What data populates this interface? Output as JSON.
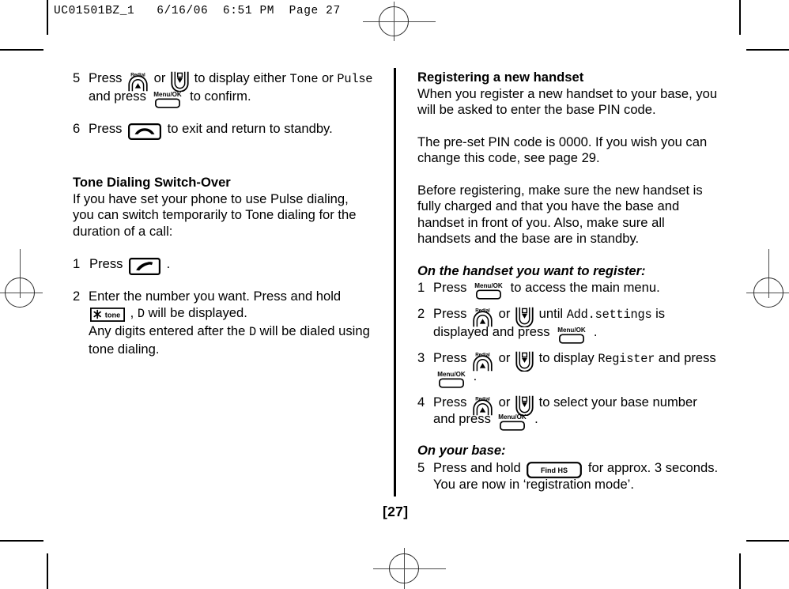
{
  "slug": {
    "text": "UC01501BZ_1   6/16/06  6:51 PM  Page 27"
  },
  "folio": {
    "page_number": "[27]"
  },
  "left_column": {
    "steps_continued": [
      {
        "number": "5",
        "parts": [
          {
            "type": "text",
            "value": "Press "
          },
          {
            "type": "icon",
            "icon": "redial-up-key"
          },
          {
            "type": "text",
            "value": " or "
          },
          {
            "type": "icon",
            "icon": "down-arrow-key"
          },
          {
            "type": "text",
            "value": " to display either "
          },
          {
            "type": "lcd",
            "value": "Tone"
          },
          {
            "type": "text",
            "value": " or "
          },
          {
            "type": "lcd",
            "value": "Pulse"
          },
          {
            "type": "text",
            "value": " and press "
          },
          {
            "type": "icon",
            "icon": "menu-ok-key"
          },
          {
            "type": "text",
            "value": " to confirm."
          }
        ]
      },
      {
        "number": "6",
        "parts": [
          {
            "type": "text",
            "value": "Press "
          },
          {
            "type": "icon",
            "icon": "hangup-key"
          },
          {
            "type": "text",
            "value": " to exit and return to standby."
          }
        ]
      }
    ],
    "section": {
      "heading": "Tone Dialing Switch-Over",
      "intro": "If you have set your phone to use Pulse dialing, you can switch temporarily to Tone dialing for the duration of a call:",
      "steps": [
        {
          "number": "1",
          "parts": [
            {
              "type": "text",
              "value": "Press "
            },
            {
              "type": "icon",
              "icon": "talk-key"
            },
            {
              "type": "text",
              "value": " ."
            }
          ]
        },
        {
          "number": "2",
          "parts": [
            {
              "type": "text",
              "value": "Enter the number you want. Press and hold "
            },
            {
              "type": "icon",
              "icon": "star-tone-key"
            },
            {
              "type": "text",
              "value": " , "
            },
            {
              "type": "lcd",
              "value": "D"
            },
            {
              "type": "text",
              "value": " will be displayed."
            },
            {
              "type": "break"
            },
            {
              "type": "text",
              "value": "Any digits entered after the "
            },
            {
              "type": "lcd",
              "value": "D"
            },
            {
              "type": "text",
              "value": " will be dialed using tone dialing."
            }
          ]
        }
      ]
    }
  },
  "right_column": {
    "heading": "Registering a new handset",
    "paragraphs": [
      "When you register a new handset to your base, you will be asked to enter the base PIN code.",
      "The pre-set PIN code is 0000. If you wish you can change this code, see page 29.",
      "Before registering, make sure the new handset is fully charged and that you have the base and handset in front of you. Also, make sure all handsets and the base are in standby."
    ],
    "handset_subheading": "On the handset you want to register:",
    "handset_steps": [
      {
        "number": "1",
        "parts": [
          {
            "type": "text",
            "value": "Press "
          },
          {
            "type": "icon",
            "icon": "menu-ok-key"
          },
          {
            "type": "text",
            "value": " to access the main menu."
          }
        ]
      },
      {
        "number": "2",
        "parts": [
          {
            "type": "text",
            "value": "Press "
          },
          {
            "type": "icon",
            "icon": "redial-up-key"
          },
          {
            "type": "text",
            "value": " or "
          },
          {
            "type": "icon",
            "icon": "down-arrow-key"
          },
          {
            "type": "text",
            "value": " until "
          },
          {
            "type": "lcd",
            "value": "Add.settings"
          },
          {
            "type": "text",
            "value": " is displayed and press "
          },
          {
            "type": "icon",
            "icon": "menu-ok-key"
          },
          {
            "type": "text",
            "value": " ."
          }
        ]
      },
      {
        "number": "3",
        "parts": [
          {
            "type": "text",
            "value": "Press "
          },
          {
            "type": "icon",
            "icon": "redial-up-key"
          },
          {
            "type": "text",
            "value": " or "
          },
          {
            "type": "icon",
            "icon": "down-arrow-key"
          },
          {
            "type": "text",
            "value": " to display "
          },
          {
            "type": "lcd",
            "value": "Register"
          },
          {
            "type": "text",
            "value": " and press "
          },
          {
            "type": "icon",
            "icon": "menu-ok-key"
          },
          {
            "type": "text",
            "value": " ."
          }
        ]
      },
      {
        "number": "4",
        "parts": [
          {
            "type": "text",
            "value": "Press "
          },
          {
            "type": "icon",
            "icon": "redial-up-key"
          },
          {
            "type": "text",
            "value": " or "
          },
          {
            "type": "icon",
            "icon": "down-arrow-key"
          },
          {
            "type": "text",
            "value": " to select your base number and press "
          },
          {
            "type": "icon",
            "icon": "menu-ok-key"
          },
          {
            "type": "text",
            "value": " ."
          }
        ]
      }
    ],
    "base_subheading": "On your base:",
    "base_steps": [
      {
        "number": "5",
        "parts": [
          {
            "type": "text",
            "value": "Press and hold "
          },
          {
            "type": "icon",
            "icon": "find-hs-key"
          },
          {
            "type": "text",
            "value": " for approx. 3 seconds."
          },
          {
            "type": "break"
          },
          {
            "type": "text",
            "value": "You are now in ‘registration mode’."
          }
        ]
      }
    ]
  },
  "icon_labels": {
    "redial": "Redial",
    "menu_ok": "Menu/OK",
    "star_tone": "tone",
    "find_hs": "Find HS"
  },
  "colors": {
    "ink": "#000000",
    "registration_mark": "#4a4a4a"
  }
}
